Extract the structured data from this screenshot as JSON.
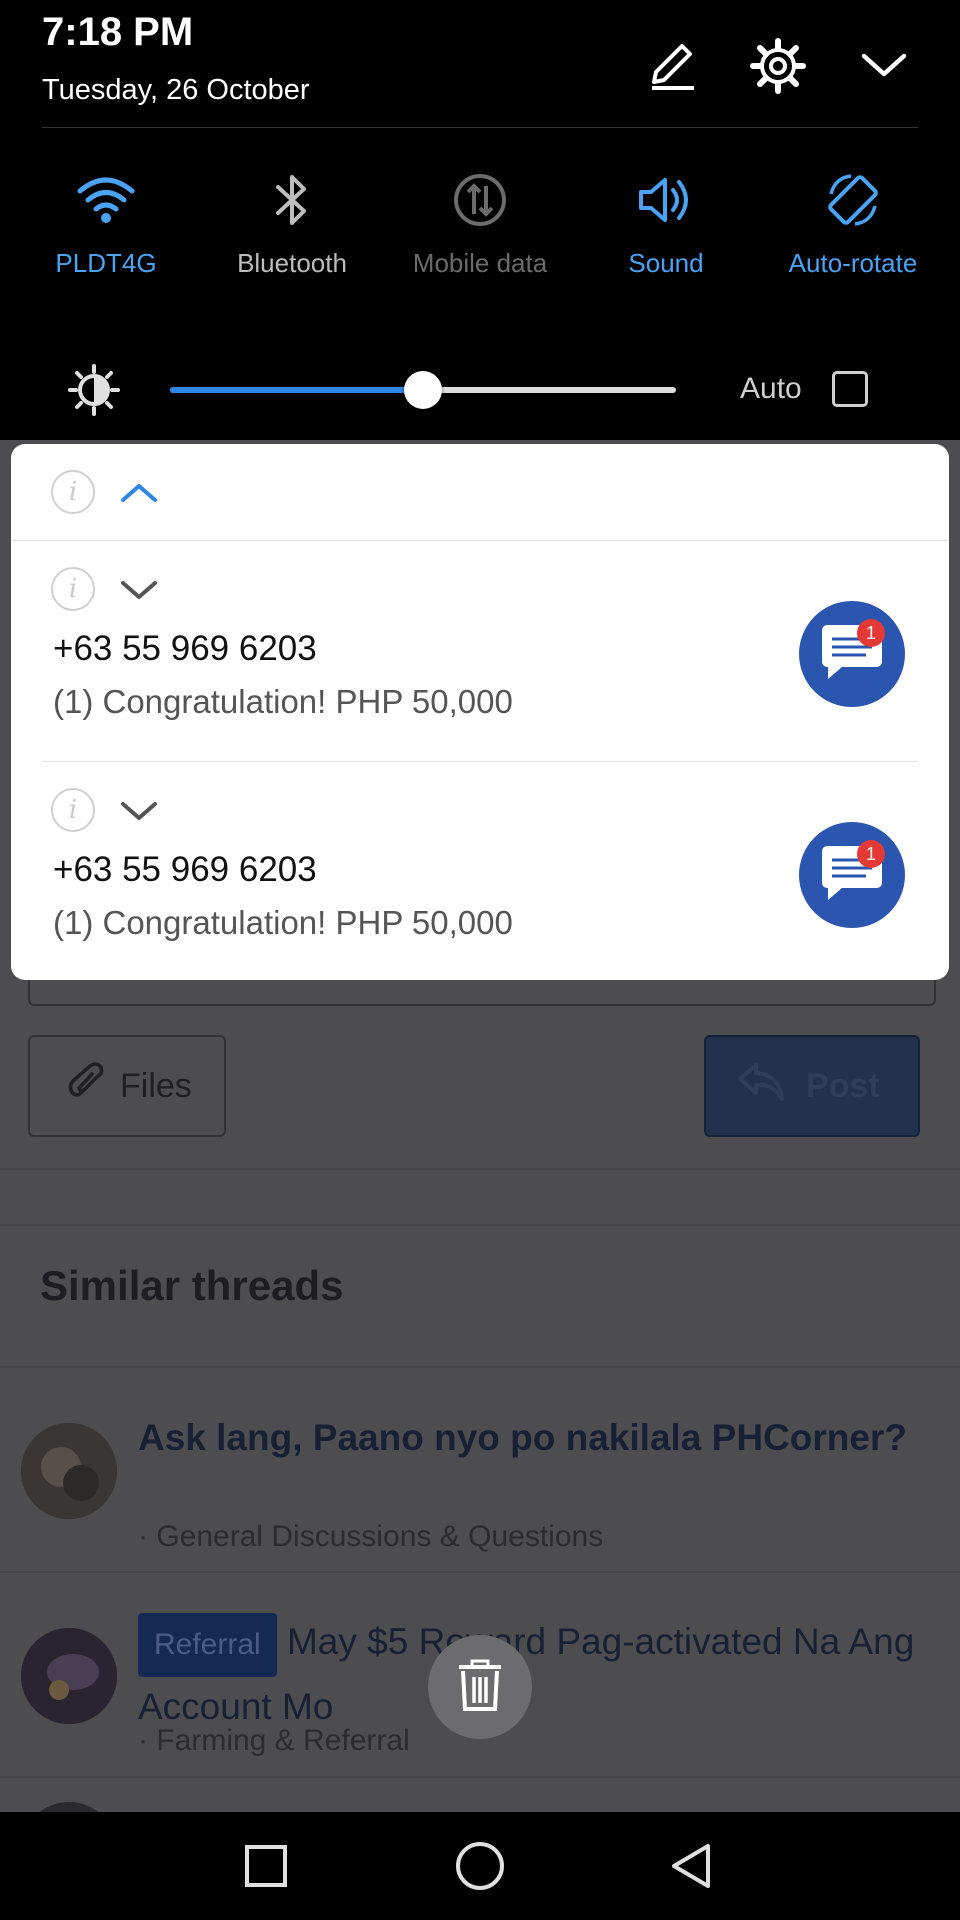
{
  "status": {
    "time": "7:18 PM",
    "date": "Tuesday, 26 October"
  },
  "header_icons": [
    "edit-icon",
    "settings-gear-icon",
    "collapse-chevron-icon"
  ],
  "quick_settings": [
    {
      "label": "PLDT4G",
      "icon": "wifi-icon",
      "state": "on"
    },
    {
      "label": "Bluetooth",
      "icon": "bluetooth-icon",
      "state": "off"
    },
    {
      "label": "Mobile data",
      "icon": "mobile-data-icon",
      "state": "disabled"
    },
    {
      "label": "Sound",
      "icon": "sound-icon",
      "state": "on"
    },
    {
      "label": "Auto-rotate",
      "icon": "auto-rotate-icon",
      "state": "on"
    }
  ],
  "brightness": {
    "level": 0.5,
    "auto_label": "Auto",
    "auto_checked": false
  },
  "notifications": [
    {
      "title": "+63 55 969 6203",
      "body": "(1) Congratulation! PHP 50,000",
      "badge": "1"
    },
    {
      "title": "+63 55 969 6203",
      "body": "(1) Congratulation! PHP 50,000",
      "badge": "1"
    }
  ],
  "background_page": {
    "files_label": "Files",
    "post_label": "Post",
    "similar_title": "Similar threads",
    "threads": [
      {
        "badge": "",
        "title": "Ask lang, Paano nyo po nakilala PHCorner?",
        "sub": "· General Discussions & Questions"
      },
      {
        "badge": "Referral",
        "title": "May $5 Reward Pag-activated Na Ang Account Mo",
        "sub": "· Farming & Referral"
      }
    ]
  },
  "colors": {
    "accent": "#2f86e9",
    "tile_on": "#4aa3f5",
    "message_icon": "#2a56b0",
    "badge_red": "#e53935"
  }
}
